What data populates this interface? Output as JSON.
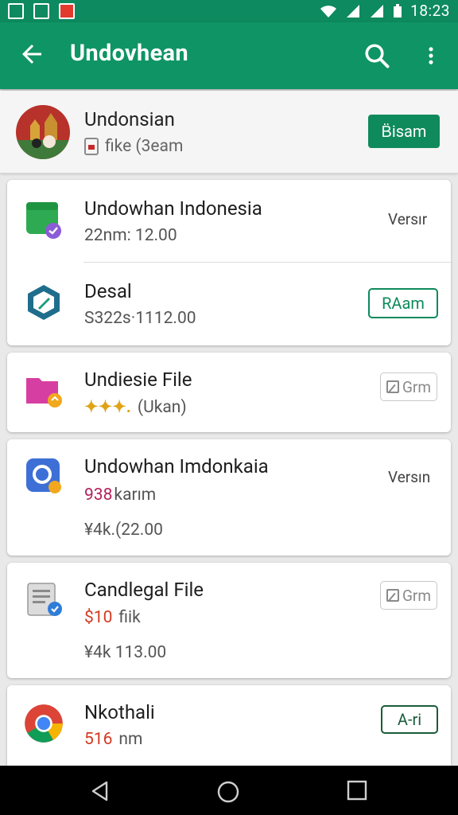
{
  "status_bar": {
    "time": "18:23"
  },
  "app_bar": {
    "title": "Undovhean"
  },
  "header": {
    "title": "Undonsian",
    "subtitle": "fike (3eam",
    "button_label": "B̈isam"
  },
  "items": [
    {
      "title": "Undowhan Indonesia",
      "subtitle": "22nm: 12.00",
      "action": "Versır"
    },
    {
      "title": "Desal",
      "subtitle": "S322s·1112.00",
      "action": "RAam"
    },
    {
      "title": "Undiesie File",
      "badge": "✦✦✦.",
      "subtitle": "(Ukan)",
      "action": "Grm"
    },
    {
      "title": "Undowhan Imdonkaia",
      "highlight": "938",
      "subtitle": "karım",
      "price": "¥4k.(22.00",
      "action": "Versın"
    },
    {
      "title": "Candlegal File",
      "highlight": "$10",
      "subtitle": "fiik",
      "price": "¥4k 113.00",
      "action": "Grm"
    },
    {
      "title": "Nkothali",
      "highlight": "516",
      "subtitle": "nm",
      "action": "A-ri"
    }
  ],
  "colors": {
    "primary": "#0f9466",
    "status_bar": "#0d8a5f",
    "accent_red": "#c62828"
  }
}
